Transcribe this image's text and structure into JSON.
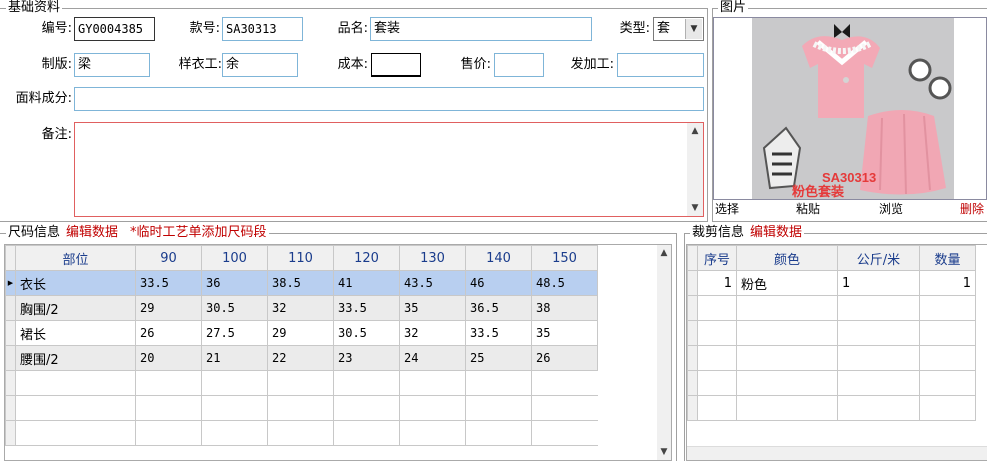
{
  "basic": {
    "title": "基础资料",
    "fields": {
      "code_label": "编号:",
      "code_value": "GY0004385",
      "style_label": "款号:",
      "style_value": "SA30313",
      "name_label": "品名:",
      "name_value": "套装",
      "type_label": "类型:",
      "type_value": "套",
      "pattern_label": "制版:",
      "pattern_value": "梁",
      "sample_label": "样衣工:",
      "sample_value": "余",
      "cost_label": "成本:",
      "cost_value": "",
      "price_label": "售价:",
      "price_value": "",
      "processor_label": "发加工:",
      "processor_value": "",
      "fabric_label": "面料成分:",
      "fabric_value": "",
      "note_label": "备注:",
      "note_value": ""
    }
  },
  "picture": {
    "title": "图片",
    "overlay_line1": "SA30313",
    "overlay_line2": "粉色套装",
    "buttons": {
      "select": "选择",
      "paste": "粘贴",
      "browse": "浏览",
      "delete": "删除"
    }
  },
  "size": {
    "title": "尺码信息",
    "edit_link": "编辑数据",
    "note": "*临时工艺单添加尺码段",
    "columns": [
      "部位",
      "90",
      "100",
      "110",
      "120",
      "130",
      "140",
      "150"
    ],
    "rows": [
      [
        "衣长",
        "33.5",
        "36",
        "38.5",
        "41",
        "43.5",
        "46",
        "48.5"
      ],
      [
        "胸围/2",
        "29",
        "30.5",
        "32",
        "33.5",
        "35",
        "36.5",
        "38"
      ],
      [
        "裙长",
        "26",
        "27.5",
        "29",
        "30.5",
        "32",
        "33.5",
        "35"
      ],
      [
        "腰围/2",
        "20",
        "21",
        "22",
        "23",
        "24",
        "25",
        "26"
      ]
    ]
  },
  "cut": {
    "title": "裁剪信息",
    "edit_link": "编辑数据",
    "columns": [
      "序号",
      "颜色",
      "公斤/米",
      "数量"
    ],
    "rows": [
      [
        "1",
        "粉色",
        "1",
        "1"
      ]
    ]
  },
  "colors": {
    "accent_red": "#c00000",
    "header_blue": "#1a3c8c",
    "selected_row": "#b8cff0",
    "field_border": "#7fb5d8"
  }
}
